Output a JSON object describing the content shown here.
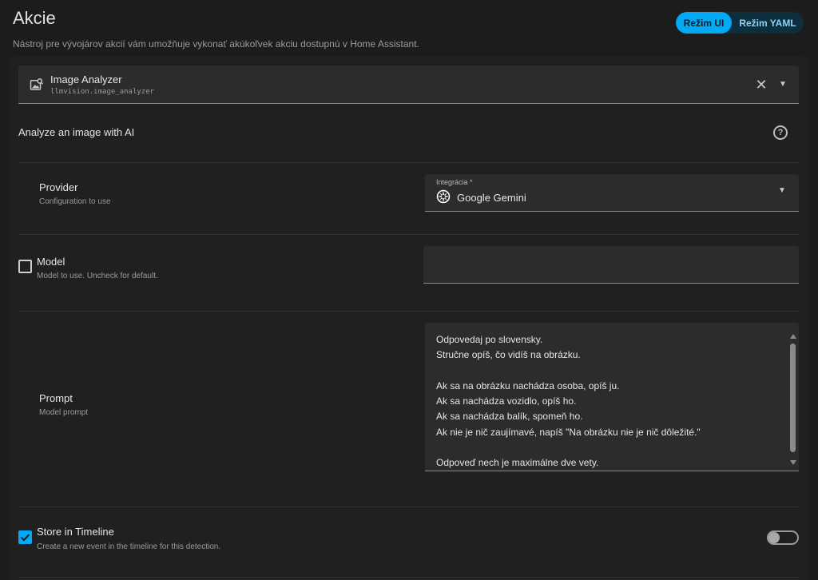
{
  "header": {
    "title": "Akcie",
    "description": "Nástroj pre vývojárov akcií vám umožňuje vykonať akúkoľvek akciu dostupnú v Home Assistant.",
    "mode_ui_label": "Režim UI",
    "mode_yaml_label": "Režim YAML"
  },
  "action_picker": {
    "title": "Image Analyzer",
    "service": "llmvision.image_analyzer",
    "clear_icon": "close-icon",
    "caret_icon": "chevron-down-icon"
  },
  "action_section": {
    "title": "Analyze an image with AI",
    "help_icon": "help-circle-icon",
    "help_glyph": "?"
  },
  "fields": {
    "provider": {
      "label": "Provider",
      "description": "Configuration to use",
      "select_label": "Integrácia *",
      "value": "Google Gemini",
      "icon": "gemini-icon"
    },
    "model": {
      "label": "Model",
      "description": "Model to use. Uncheck for default.",
      "enabled": false,
      "value": ""
    },
    "prompt": {
      "label": "Prompt",
      "description": "Model prompt",
      "value": "Odpovedaj po slovensky.\nStručne opíš, čo vidíš na obrázku.\n\nAk sa na obrázku nachádza osoba, opíš ju.\nAk sa nachádza vozidlo, opíš ho.\nAk sa nachádza balík, spomeň ho.\nAk nie je nič zaujímavé, napíš \"Na obrázku nie je nič dôležité.\"\n\nOdpoveď nech je maximálne dve vety."
    },
    "store_in_timeline": {
      "label": "Store in Timeline",
      "description": "Create a new event in the timeline for this detection.",
      "enabled": true,
      "switch_on": false
    }
  },
  "colors": {
    "accent": "#03a9f4",
    "background": "#1c1c1c",
    "field_bg": "#2c2c2c"
  }
}
